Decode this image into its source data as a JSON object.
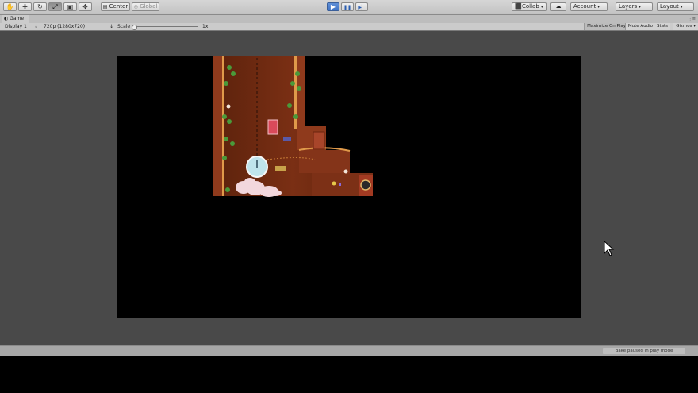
{
  "toolbar": {
    "tools": [
      {
        "name": "hand-tool-icon",
        "glyph": "✋",
        "active": false
      },
      {
        "name": "move-tool-icon",
        "glyph": "✚",
        "active": false
      },
      {
        "name": "rotate-tool-icon",
        "glyph": "↻",
        "active": false
      },
      {
        "name": "scale-tool-icon",
        "glyph": "⤢",
        "active": true
      },
      {
        "name": "rect-tool-icon",
        "glyph": "▣",
        "active": false
      },
      {
        "name": "transform-tool-icon",
        "glyph": "✥",
        "active": false
      }
    ],
    "pivot_label": "Center",
    "space_label": "Global",
    "play_glyph": "▶",
    "pause_glyph": "❚❚",
    "step_glyph": "▶▏",
    "collab_label": "Collab",
    "cloud_glyph": "☁",
    "account_label": "Account",
    "layers_label": "Layers",
    "layout_label": "Layout"
  },
  "tab": {
    "icon": "◐",
    "label": "Game",
    "menu_glyph": "⋮≡"
  },
  "game_toolbar": {
    "display_label": "Display 1",
    "resolution_label": "720p (1280x720)",
    "scale_label": "Scale",
    "scale_value": "1x",
    "scale_slider_value": 0,
    "maximize_label": "Maximize On Play",
    "mute_label": "Mute Audio",
    "stats_label": "Stats",
    "gizmos_label": "Gizmos"
  },
  "status": {
    "message": "Bake paused in play mode"
  },
  "colors": {
    "accent_play": "#3f74c6",
    "cave_wall": "#8f3a1c",
    "cave_bg": "#6a2a12",
    "sand_edge": "#e09a4a",
    "vine_green": "#4a9a3a",
    "bubble": "#f2d7dd",
    "clock_face": "#bfe4ec"
  }
}
